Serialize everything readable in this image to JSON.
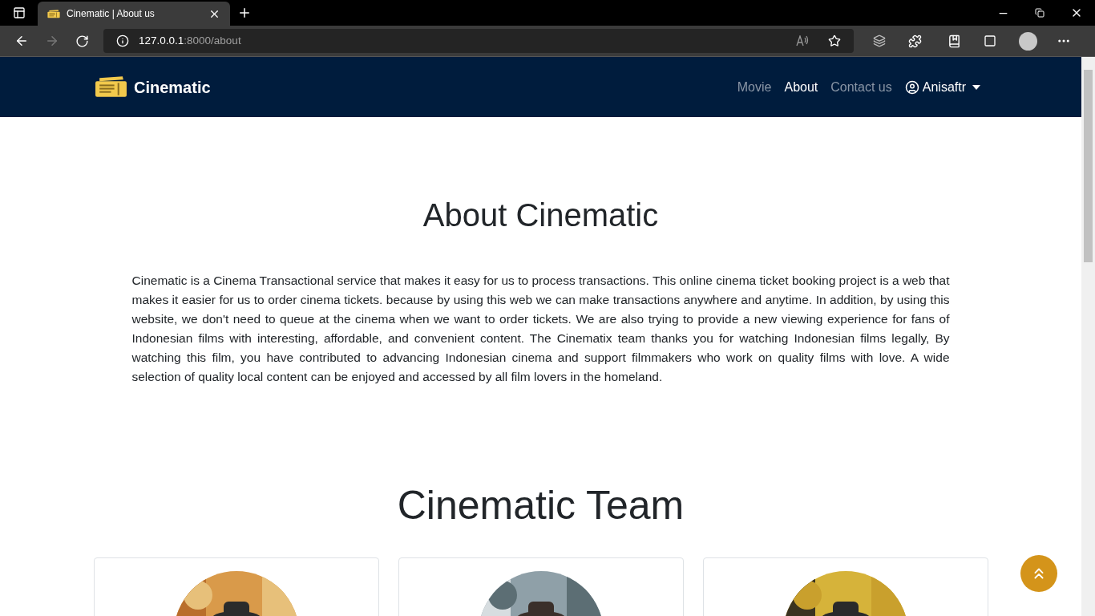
{
  "browser": {
    "tab_title": "Cinematic | About us",
    "url_host": "127.0.0.1",
    "url_path": ":8000/about"
  },
  "navbar": {
    "brand": "Cinematic",
    "links": [
      {
        "label": "Movie",
        "selected": false
      },
      {
        "label": "About",
        "selected": true
      },
      {
        "label": "Contact us",
        "selected": false
      }
    ],
    "user": "Anisaftr"
  },
  "about": {
    "title": "About Cinematic",
    "text": "Cinematic is a Cinema Transactional service that makes it easy for us to process transactions. This online cinema ticket booking project is a web that makes it easier for us to order cinema tickets. because by using this web we can make transactions anywhere and anytime. In addition, by using this website, we don't need to queue at the cinema when we want to order tickets. We are also trying to provide a new viewing experience for fans of Indonesian films with interesting, affordable, and convenient content. The Cinematix team thanks you for watching Indonesian films legally, By watching this film, you have contributed to advancing Indonesian cinema and support filmmakers who work on quality films with love. A wide selection of quality local content can be enjoyed and accessed by all film lovers in the homeland."
  },
  "team": {
    "title": "Cinematic Team"
  }
}
